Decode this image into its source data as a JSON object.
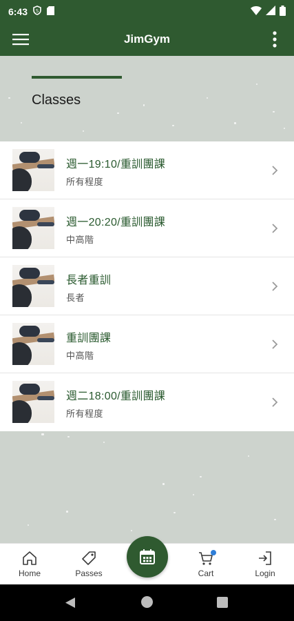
{
  "status_bar": {
    "time": "6:43"
  },
  "app_bar": {
    "title": "JimGym"
  },
  "hero": {
    "title": "Classes"
  },
  "classes": [
    {
      "title": "週一19:10/重訓團課",
      "level": "所有程度"
    },
    {
      "title": "週一20:20/重訓團課",
      "level": "中高階"
    },
    {
      "title": "長者重訓",
      "level": "長者"
    },
    {
      "title": "重訓團課",
      "level": "中高階"
    },
    {
      "title": "週二18:00/重訓團課",
      "level": "所有程度"
    }
  ],
  "bottom_nav": {
    "home": "Home",
    "passes": "Passes",
    "cart": "Cart",
    "login": "Login"
  },
  "colors": {
    "brand": "#2f5a30",
    "background": "#cdd3cd",
    "cart_badge": "#2f7ed8"
  }
}
